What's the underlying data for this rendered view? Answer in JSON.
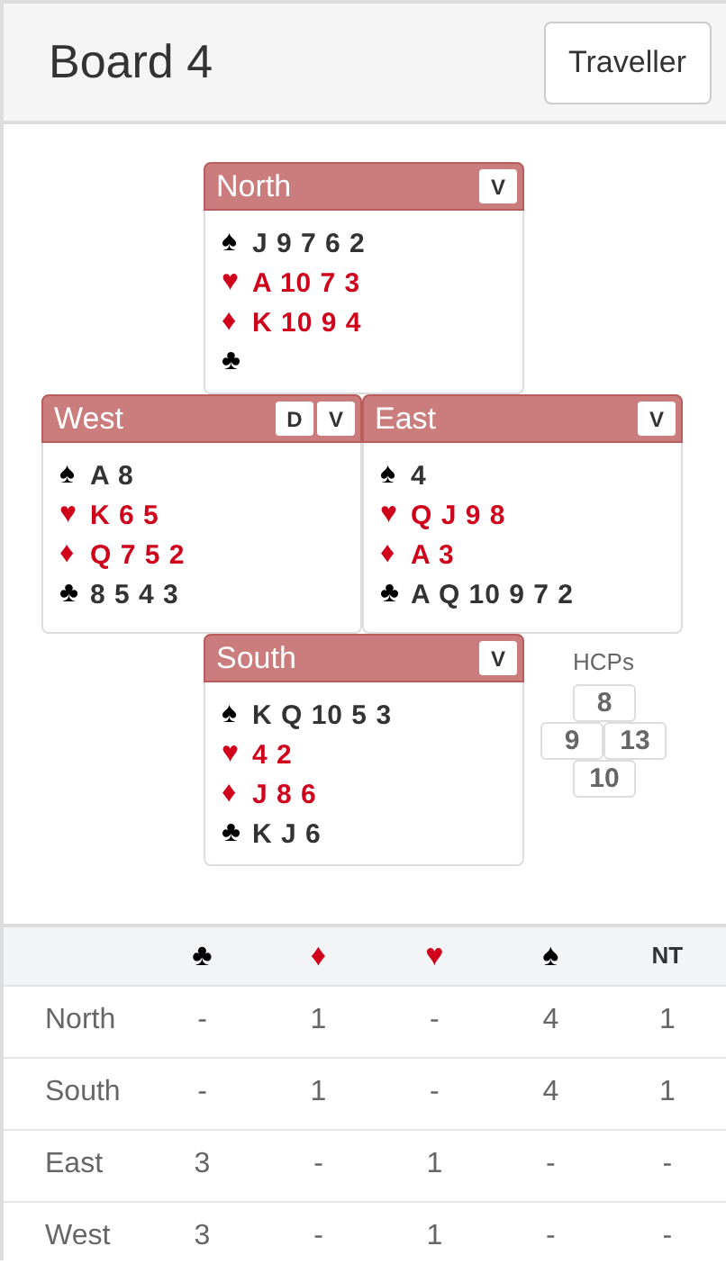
{
  "header": {
    "title": "Board 4",
    "button": "Traveller"
  },
  "hands": [
    {
      "seat": "North",
      "badges": [
        "V"
      ],
      "holdings": [
        {
          "suit": "♠",
          "cards": "J 9 7 6 2",
          "color": "#000000"
        },
        {
          "suit": "♥",
          "cards": "A 10 7 3",
          "color": "#d0021b"
        },
        {
          "suit": "♦",
          "cards": "K 10 9 4",
          "color": "#d0021b"
        },
        {
          "suit": "♣",
          "color": "#000000"
        }
      ]
    },
    {
      "seat": "West",
      "badges": [
        "D",
        "V"
      ],
      "holdings": [
        {
          "suit": "♠",
          "cards": "A 8",
          "color": "#000000"
        },
        {
          "suit": "♥",
          "cards": "K 6 5",
          "color": "#d0021b"
        },
        {
          "suit": "♦",
          "cards": "Q 7 5 2",
          "color": "#d0021b"
        },
        {
          "suit": "♣",
          "cards": "8 5 4 3",
          "color": "#000000"
        }
      ]
    },
    {
      "seat": "East",
      "badges": [
        "V"
      ],
      "holdings": [
        {
          "suit": "♠",
          "cards": "4",
          "color": "#000000"
        },
        {
          "suit": "♥",
          "cards": "Q J 9 8",
          "color": "#d0021b"
        },
        {
          "suit": "♦",
          "cards": "A 3",
          "color": "#d0021b"
        },
        {
          "suit": "♣",
          "cards": "A Q 10 9 7 2",
          "color": "#000000"
        }
      ]
    },
    {
      "seat": "South",
      "badges": [
        "V"
      ],
      "holdings": [
        {
          "suit": "♠",
          "cards": "K Q 10 5 3",
          "color": "#000000"
        },
        {
          "suit": "♥",
          "cards": "4 2",
          "color": "#d0021b"
        },
        {
          "suit": "♦",
          "cards": "J 8 6",
          "color": "#d0021b"
        },
        {
          "suit": "♣",
          "cards": "K J 6",
          "color": "#000000"
        }
      ]
    }
  ],
  "hcps": {
    "label": "HCPs",
    "north": "8",
    "west": "9",
    "east": "13",
    "south": "10"
  },
  "table": {
    "columns": [
      {
        "label": "♣",
        "color": "#000000"
      },
      {
        "label": "♦",
        "color": "#d0021b"
      },
      {
        "label": "♥",
        "color": "#d0021b"
      },
      {
        "label": "♠",
        "color": "#000000"
      },
      {
        "label": "NT",
        "color": "#333333"
      }
    ],
    "rows": [
      {
        "seat": "North",
        "cells": [
          "-",
          "1",
          "-",
          "4",
          "1"
        ]
      },
      {
        "seat": "South",
        "cells": [
          "-",
          "1",
          "-",
          "4",
          "1"
        ]
      },
      {
        "seat": "East",
        "cells": [
          "3",
          "-",
          "1",
          "-",
          "-"
        ]
      },
      {
        "seat": "West",
        "cells": [
          "3",
          "-",
          "1",
          "-",
          "-"
        ]
      }
    ]
  }
}
